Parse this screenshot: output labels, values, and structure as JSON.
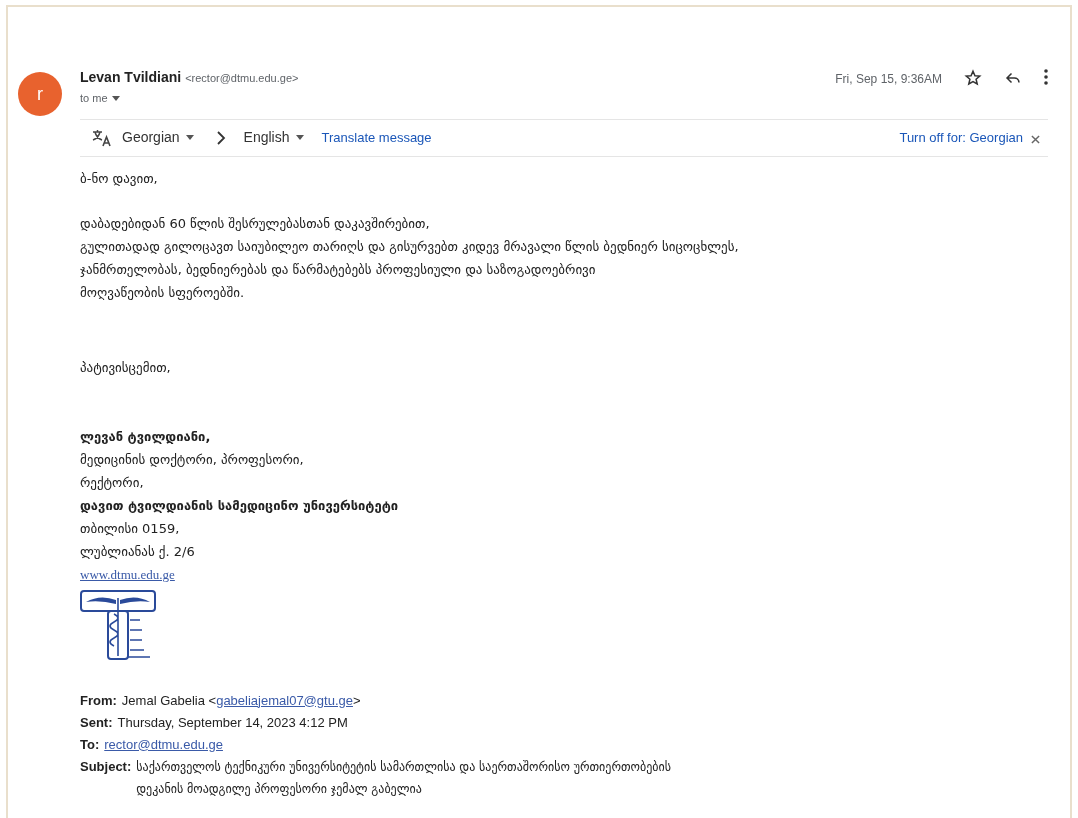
{
  "message": {
    "avatar_letter": "r",
    "sender_name": "Levan Tvildiani",
    "sender_email": "<rector@dtmu.edu.ge>",
    "recipient": "to me",
    "date": "Fri, Sep 15, 9:36AM"
  },
  "translate_bar": {
    "source_language": "Georgian",
    "target_language": "English",
    "action": "Translate message",
    "turn_off": "Turn off for: Georgian"
  },
  "body": [
    {
      "lines": [
        "ბ-ნო დავით,"
      ]
    },
    {
      "lines": [
        "დაბადებიდან 60 წლის შესრულებასთან დაკავშირებით,",
        "გულითადად გილოცავთ საიუბილეო თარიღს და გისურვებთ კიდევ მრავალი წლის ბედნიერ სიცოცხლეს,",
        "ჯანმრთელობას, ბედნიერებას და წარმატებებს პროფესიული და საზოგადოებრივი",
        "მოღვაწეობის სფეროებში."
      ]
    },
    {
      "lines": [
        "პატივისცემით,"
      ]
    }
  ],
  "signature": [
    {
      "text": "ლევან ტვილდიანი,",
      "kind": "bold"
    },
    {
      "text": "მედიცინის დოქტორი, პროფესორი,",
      "kind": "plain"
    },
    {
      "text": "რექტორი,",
      "kind": "plain"
    },
    {
      "text": "დავით ტვილდიანის სამედიცინო უნივერსიტეტი",
      "kind": "bold"
    },
    {
      "text": "თბილისი 0159,",
      "kind": "plain"
    },
    {
      "text": "ლუბლიანას ქ. 2/6",
      "kind": "plain"
    },
    {
      "text": "www.dtmu.edu.ge",
      "kind": "link"
    }
  ],
  "quoted_header": [
    {
      "label": "From:",
      "parts": [
        {
          "text": "Jemal Gabelia <",
          "link": false
        },
        {
          "text": "gabeliajemal07@gtu.ge",
          "link": true
        },
        {
          "text": ">",
          "link": false
        }
      ]
    },
    {
      "label": "Sent:",
      "parts": [
        {
          "text": "Thursday, September 14, 2023 4:12 PM",
          "link": false
        }
      ]
    },
    {
      "label": "To:",
      "parts": [
        {
          "text": "rector@dtmu.edu.ge",
          "link": true
        }
      ]
    },
    {
      "label": "Subject:",
      "parts": [
        {
          "text": "საქართველოს ტექნიკური უნივერსიტეტის სამართლისა და საერთაშორისო ურთიერთობების",
          "link": false
        },
        {
          "text": "დეკანის მოადგილე პროფესორი ჯემალ გაბელია",
          "link": false
        }
      ]
    }
  ]
}
